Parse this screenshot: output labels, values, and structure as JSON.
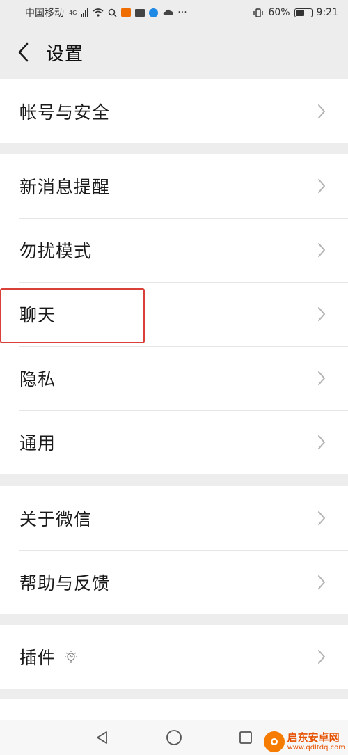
{
  "status_bar": {
    "carrier": "中国移动",
    "network": "4G",
    "battery": "60%",
    "battery_level": 0.6,
    "time": "9:21",
    "more": "···"
  },
  "header": {
    "title": "设置"
  },
  "groups": [
    {
      "items": [
        {
          "label": "帐号与安全"
        }
      ]
    },
    {
      "items": [
        {
          "label": "新消息提醒"
        },
        {
          "label": "勿扰模式"
        },
        {
          "label": "聊天"
        },
        {
          "label": "隐私"
        },
        {
          "label": "通用"
        }
      ]
    },
    {
      "items": [
        {
          "label": "关于微信"
        },
        {
          "label": "帮助与反馈"
        }
      ]
    },
    {
      "items": [
        {
          "label": "插件"
        }
      ]
    }
  ],
  "watermark": {
    "name": "启东安卓网",
    "url": "www.qdltdq.com"
  },
  "colors": {
    "background": "#ededed",
    "highlight_border": "#d9403a",
    "watermark": "#e65100"
  }
}
